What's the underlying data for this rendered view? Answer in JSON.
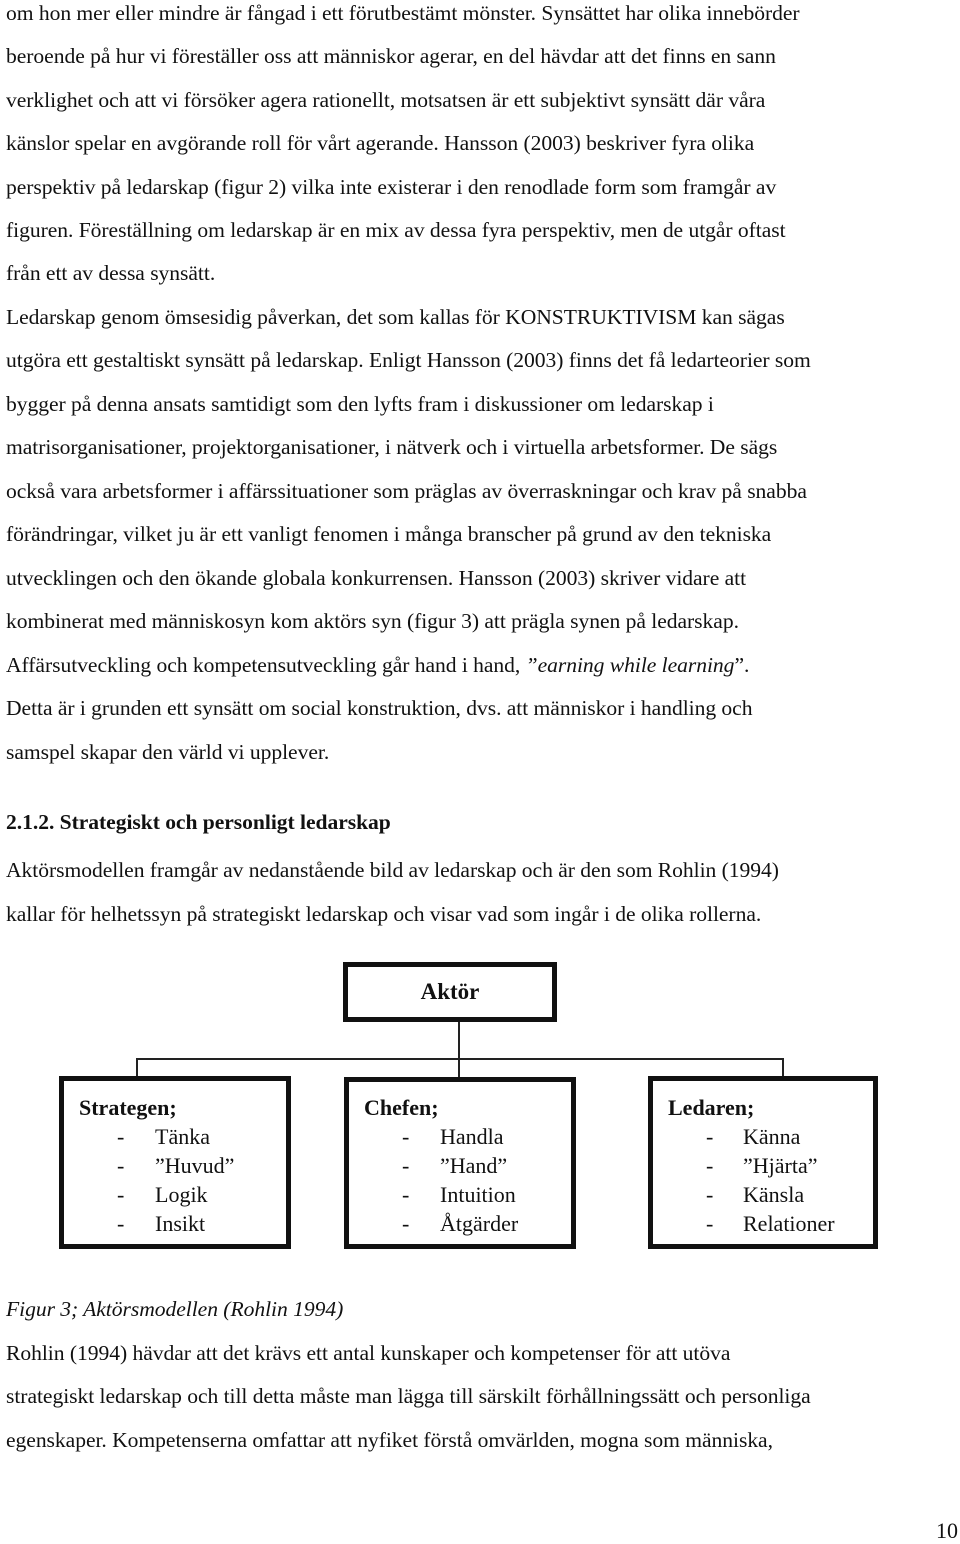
{
  "paragraph1": {
    "lines": [
      "om hon mer eller mindre är fångad i ett förutbestämt mönster. Synsättet har olika innebörder",
      "beroende på hur vi föreställer oss att människor agerar, en del hävdar att det finns en sann",
      "verklighet och att vi försöker agera rationellt, motsatsen är ett subjektivt synsätt där våra",
      "känslor spelar en avgörande roll för vårt agerande. Hansson (2003) beskriver fyra olika",
      "perspektiv på ledarskap (figur 2) vilka inte existerar i den renodlade form som framgår av",
      "figuren. Föreställning om ledarskap är en mix av dessa fyra perspektiv, men de utgår oftast",
      "från ett av dessa synsätt."
    ]
  },
  "paragraph2": {
    "lines": [
      "Ledarskap genom ömsesidig påverkan, det som kallas för KONSTRUKTIVISM kan sägas",
      "utgöra ett gestaltiskt synsätt på ledarskap. Enligt Hansson (2003) finns det få ledarteorier som",
      "bygger på denna ansats samtidigt som den lyfts fram i diskussioner om ledarskap i",
      "matrisorganisationer, projektorganisationer, i nätverk och i virtuella arbetsformer. De sägs",
      "också vara arbetsformer i affärssituationer som präglas av överraskningar och krav på snabba",
      "förändringar, vilket ju är ett vanligt fenomen i många branscher på grund av den tekniska",
      "utvecklingen och den ökande globala konkurrensen. Hansson (2003) skriver vidare att",
      "kombinerat med människosyn kom aktörs syn (figur 3) att prägla synen på ledarskap."
    ],
    "line9_prefix": "Affärsutveckling och kompetensutveckling går hand i hand, ",
    "line9_quote_open": "”",
    "line9_italic": "earning while learning",
    "line9_quote_close": "”.",
    "lines_after": [
      "Detta är i grunden ett synsätt om social konstruktion, dvs. att människor i handling och",
      "samspel skapar den värld vi upplever."
    ]
  },
  "section": {
    "heading": "2.1.2. Strategiskt och personligt ledarskap",
    "lines": [
      "Aktörsmodellen framgår av nedanstående bild av ledarskap och är den som Rohlin (1994)",
      "kallar för helhetssyn på strategiskt ledarskap och visar vad som ingår i de olika rollerna."
    ]
  },
  "diagram": {
    "root": "Aktör",
    "roles": [
      {
        "title": "Strategen;",
        "items": [
          "Tänka",
          "”Huvud”",
          "Logik",
          "Insikt"
        ]
      },
      {
        "title": "Chefen;",
        "items": [
          "Handla",
          "”Hand”",
          "Intuition",
          "Åtgärder"
        ]
      },
      {
        "title": "Ledaren;",
        "items": [
          "Känna",
          "”Hjärta”",
          "Känsla",
          "Relationer"
        ]
      }
    ],
    "bullet": "-"
  },
  "caption": "Figur 3; Aktörsmodellen (Rohlin 1994)",
  "paragraph3": {
    "lines": [
      "Rohlin (1994) hävdar att det krävs ett antal kunskaper och kompetenser för att utöva",
      "strategiskt ledarskap och till detta måste man lägga till särskilt förhållningssätt och personliga",
      "egenskaper. Kompetenserna omfattar att nyfiket förstå omvärlden, mogna som människa,"
    ]
  },
  "page_number": "10"
}
